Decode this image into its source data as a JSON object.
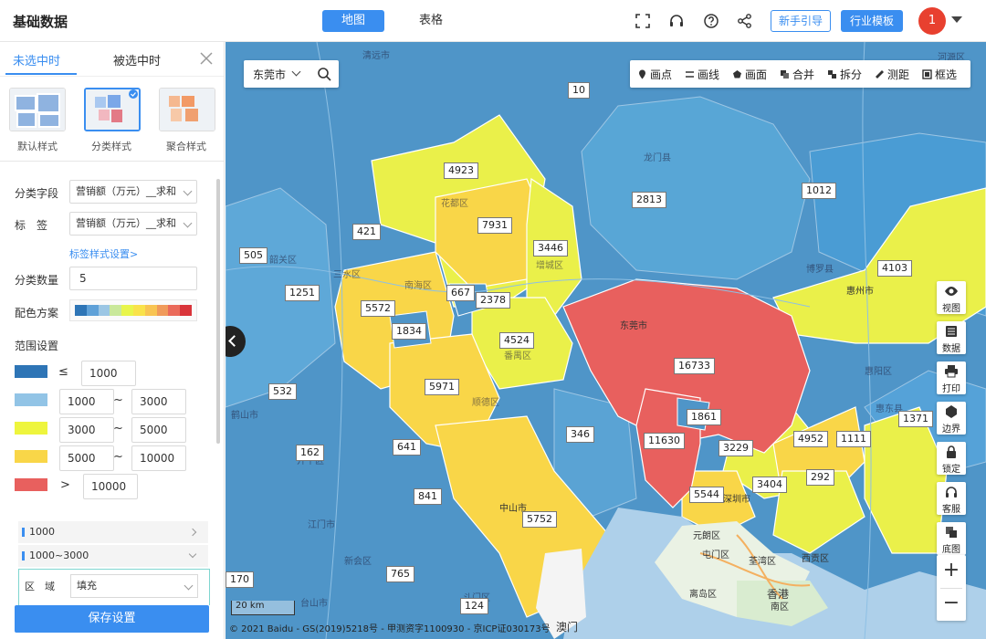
{
  "header": {
    "app_title": "基础数据",
    "tabs": [
      {
        "label": "地图",
        "active": true
      },
      {
        "label": "表格",
        "active": false
      }
    ],
    "icons": [
      "fullscreen-icon",
      "headset-icon",
      "help-icon",
      "share-icon"
    ],
    "guide_button": "新手引导",
    "template_button": "行业模板",
    "avatar_text": "1"
  },
  "sidebar": {
    "tabs": [
      "未选中时",
      "被选中时"
    ],
    "styles": [
      {
        "label": "默认样式",
        "selected": false
      },
      {
        "label": "分类样式",
        "selected": true
      },
      {
        "label": "聚合样式",
        "selected": false
      }
    ],
    "classify_field": {
      "label": "分类字段",
      "value": "营销额（万元）__求和"
    },
    "label_field": {
      "label": "标　签",
      "value": "营销额（万元）__求和"
    },
    "label_style_link": "标签样式设置>",
    "class_count": {
      "label": "分类数量",
      "value": "5"
    },
    "color_scheme": {
      "label": "配色方案",
      "colors": [
        "#2e75b6",
        "#5fa1d8",
        "#9bc6e4",
        "#c9e89a",
        "#e8f54a",
        "#f9e24a",
        "#f8c452",
        "#f09a5a",
        "#ea6a5a",
        "#d9343a"
      ]
    },
    "range_title": "范围设置",
    "ranges": [
      {
        "color": "#2e75b6",
        "op": "≤",
        "min": "",
        "max": "1000"
      },
      {
        "color": "#92c4e6",
        "op": "~",
        "min": "1000",
        "max": "3000"
      },
      {
        "color": "#eef53d",
        "op": "~",
        "min": "3000",
        "max": "5000"
      },
      {
        "color": "#f9d648",
        "op": "~",
        "min": "5000",
        "max": "10000"
      },
      {
        "color": "#e8605e",
        "op": ">",
        "min": "",
        "max": "10000"
      }
    ],
    "accordion": [
      {
        "label": "1000"
      },
      {
        "label": "1000~3000"
      }
    ],
    "area": {
      "label": "区　域",
      "value": "填充"
    },
    "save_button": "保存设置"
  },
  "map": {
    "city": "东莞市",
    "draw_tools": [
      "画点",
      "画线",
      "画面",
      "合并",
      "拆分",
      "测距",
      "框选"
    ],
    "side_tools": [
      "视图",
      "数据",
      "打印",
      "边界",
      "锁定",
      "客服",
      "底图"
    ],
    "zoom_in": "+",
    "zoom_out": "−",
    "scale": "20 km",
    "copyright": "© 2021 Baidu - GS(2019)5218号 - 甲测资字1100930 - 京ICP证030173号",
    "values": [
      "10",
      "4923",
      "2813",
      "1012",
      "7931",
      "421",
      "3446",
      "505",
      "4103",
      "1251",
      "667",
      "2378",
      "5572",
      "1834",
      "4524",
      "16733",
      "5971",
      "532",
      "1861",
      "1371",
      "11630",
      "3229",
      "4952",
      "1111",
      "162",
      "641",
      "346",
      "3404",
      "292",
      "5544",
      "841",
      "5752",
      "765",
      "170",
      "124"
    ],
    "places": [
      "清远市",
      "河源区",
      "韶关区",
      "三水区",
      "东莞市",
      "博罗县",
      "惠州市",
      "中山市",
      "深圳市",
      "元朗区",
      "屯门区",
      "荃湾区",
      "西贡区",
      "离岛区",
      "香港",
      "南区",
      "澳门",
      "江门市",
      "台山市",
      "开平区",
      "鹤山市",
      "顺德区",
      "番禺区",
      "南海区",
      "花都区",
      "增城区",
      "龙门县",
      "惠阳区",
      "惠东县",
      "新会区",
      "斗门区"
    ]
  }
}
